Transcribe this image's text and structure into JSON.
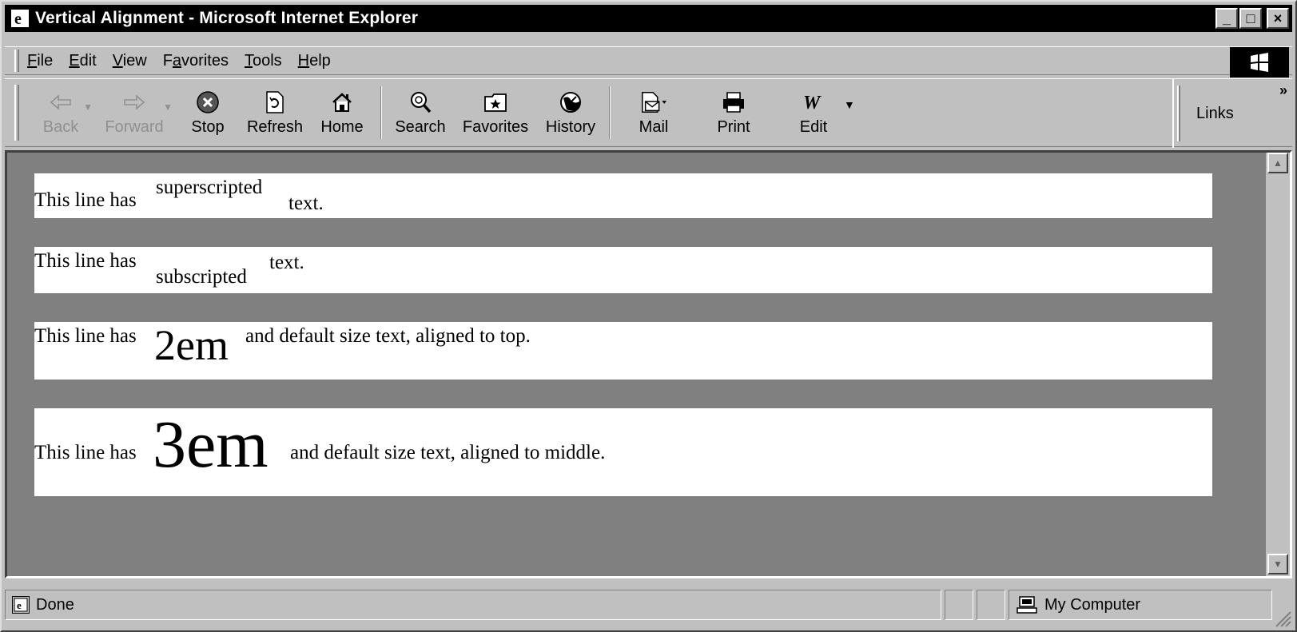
{
  "window": {
    "title": "Vertical Alignment - Microsoft Internet Explorer"
  },
  "title_buttons": {
    "minimize": "_",
    "maximize": "□",
    "close": "×"
  },
  "menu": [
    "File",
    "Edit",
    "View",
    "Favorites",
    "Tools",
    "Help"
  ],
  "menu_mnemonics": [
    "F",
    "E",
    "V",
    "a",
    "T",
    "H"
  ],
  "toolbar": {
    "back": "Back",
    "forward": "Forward",
    "stop": "Stop",
    "refresh": "Refresh",
    "home": "Home",
    "search": "Search",
    "favorites": "Favorites",
    "history": "History",
    "mail": "Mail",
    "print": "Print",
    "edit": "Edit",
    "links": "Links",
    "chevron": "»"
  },
  "icons": {
    "back": "arrow-left-icon",
    "forward": "arrow-right-icon",
    "stop": "stop-icon",
    "refresh": "refresh-icon",
    "home": "home-icon",
    "search": "search-icon",
    "favorites": "favorites-icon",
    "history": "history-icon",
    "mail": "mail-icon",
    "print": "print-icon",
    "edit": "edit-icon"
  },
  "content": {
    "line1": {
      "prefix": "This line has",
      "special": "superscripted",
      "suffix": "text."
    },
    "line2": {
      "prefix": "This line has",
      "special": "subscripted",
      "suffix": "text."
    },
    "line3": {
      "prefix": "This line has",
      "special": "2em",
      "suffix": "and default size text, aligned to top."
    },
    "line4": {
      "prefix": "This line has",
      "special": "3em",
      "suffix": "and default size text, aligned to middle."
    }
  },
  "status": {
    "text": "Done",
    "zone": "My Computer"
  },
  "colors": {
    "titlebar": "#000000",
    "chrome": "#c0c0c0",
    "page_background": "#808080",
    "paragraph_background": "#ffffff"
  }
}
